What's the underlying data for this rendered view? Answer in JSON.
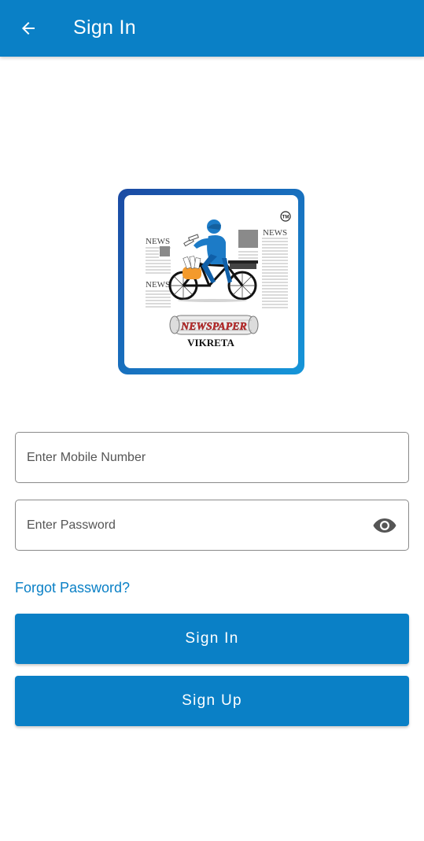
{
  "appbar": {
    "title": "Sign In",
    "back_icon": "arrow-left-icon",
    "background_color": "#0a80c6"
  },
  "logo": {
    "news_labels": [
      "NEWS",
      "NEWS",
      "NEWS"
    ],
    "banner_text": "NEWSPAPER",
    "brand_text": "VIKRETA",
    "trademark": "TM"
  },
  "form": {
    "mobile_placeholder": "Enter Mobile Number",
    "mobile_value": "",
    "password_placeholder": "Enter Password",
    "password_value": "",
    "password_toggle_icon": "eye-icon"
  },
  "links": {
    "forgot_password": "Forgot Password?"
  },
  "buttons": {
    "sign_in": "Sign In",
    "sign_up": "Sign Up"
  },
  "colors": {
    "accent": "#0a80c6",
    "field_border": "#8a8a8a"
  }
}
